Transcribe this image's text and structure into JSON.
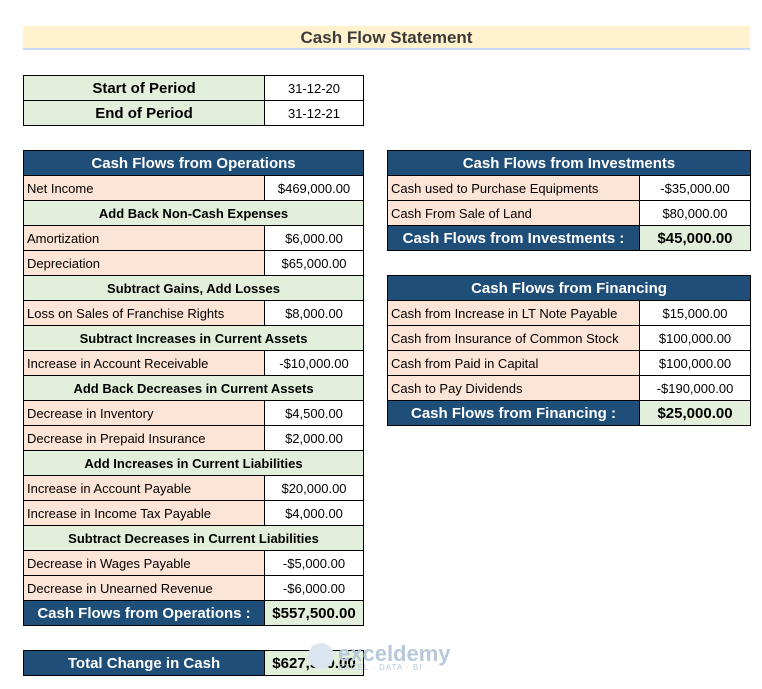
{
  "title": "Cash Flow Statement",
  "period": {
    "start_label": "Start of Period",
    "start_value": "31-12-20",
    "end_label": "End of Period",
    "end_value": "31-12-21"
  },
  "operations": {
    "header": "Cash Flows from Operations",
    "net_income_label": "Net Income",
    "net_income_value": "$469,000.00",
    "sections": [
      {
        "heading": "Add Back Non-Cash Expenses",
        "rows": [
          {
            "label": "Amortization",
            "value": "$6,000.00"
          },
          {
            "label": "Depreciation",
            "value": "$65,000.00"
          }
        ]
      },
      {
        "heading": "Subtract Gains, Add Losses",
        "rows": [
          {
            "label": "Loss on Sales of Franchise Rights",
            "value": "$8,000.00"
          }
        ]
      },
      {
        "heading": "Subtract Increases in Current Assets",
        "rows": [
          {
            "label": "Increase in Account Receivable",
            "value": "-$10,000.00"
          }
        ]
      },
      {
        "heading": "Add Back Decreases in Current Assets",
        "rows": [
          {
            "label": "Decrease in Inventory",
            "value": "$4,500.00"
          },
          {
            "label": "Decrease in Prepaid Insurance",
            "value": "$2,000.00"
          }
        ]
      },
      {
        "heading": "Add Increases in Current Liabilities",
        "rows": [
          {
            "label": "Increase in Account Payable",
            "value": "$20,000.00"
          },
          {
            "label": "Increase in Income Tax Payable",
            "value": "$4,000.00"
          }
        ]
      },
      {
        "heading": "Subtract Decreases in Current Liabilities",
        "rows": [
          {
            "label": "Decrease in Wages Payable",
            "value": "-$5,000.00"
          },
          {
            "label": "Decrease in Unearned Revenue",
            "value": "-$6,000.00"
          }
        ]
      }
    ],
    "total_label": "Cash Flows from Operations :",
    "total_value": "$557,500.00"
  },
  "investments": {
    "header": "Cash Flows from Investments",
    "rows": [
      {
        "label": "Cash used to Purchase Equipments",
        "value": "-$35,000.00"
      },
      {
        "label": "Cash From Sale of Land",
        "value": "$80,000.00"
      }
    ],
    "total_label": "Cash Flows from Investments :",
    "total_value": "$45,000.00"
  },
  "financing": {
    "header": "Cash Flows from Financing",
    "rows": [
      {
        "label": "Cash from Increase in LT Note Payable",
        "value": "$15,000.00"
      },
      {
        "label": "Cash from Insurance of Common Stock",
        "value": "$100,000.00"
      },
      {
        "label": "Cash from Paid in Capital",
        "value": "$100,000.00"
      },
      {
        "label": "Cash to Pay Dividends",
        "value": "-$190,000.00"
      }
    ],
    "total_label": "Cash Flows from Financing :",
    "total_value": "$25,000.00"
  },
  "total_change": {
    "label": "Total Change in Cash",
    "value": "$627,500.00"
  },
  "watermark": {
    "name": "exceldemy",
    "tagline": "EXCEL · DATA · BI"
  }
}
